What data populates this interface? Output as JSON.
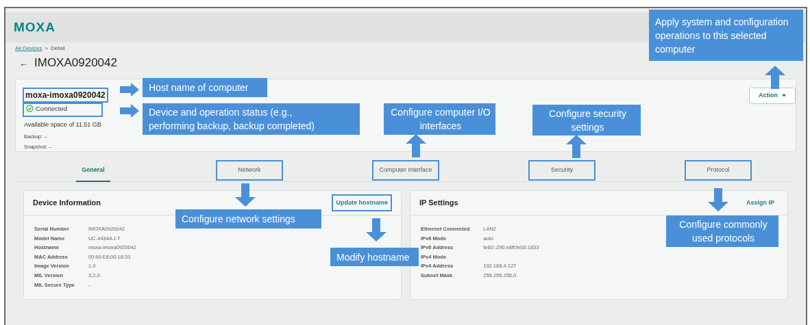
{
  "header": {
    "logo": "MOXA"
  },
  "breadcrumb": {
    "link": "All Devices",
    "separator": ">",
    "current": "Detail"
  },
  "page_title": {
    "back": "←",
    "title": "IMOXA0920042"
  },
  "summary": {
    "hostname": "moxa-imoxa0920042",
    "hostname_annotated": true,
    "status": "Connected",
    "status_annotated": true,
    "space": "Available space of 11.51 GB",
    "backup": "Backup: --",
    "snapshot": "Snapshot: --",
    "action": "Action"
  },
  "tabs": [
    {
      "label": "General",
      "selected": true,
      "annotated": false
    },
    {
      "label": "Network",
      "selected": false,
      "annotated": true
    },
    {
      "label": "Computer Interface",
      "selected": false,
      "annotated": true
    },
    {
      "label": "Security",
      "selected": false,
      "annotated": true
    },
    {
      "label": "Protocol",
      "selected": false,
      "annotated": true
    }
  ],
  "cards": [
    {
      "title": "Device Information",
      "link": "Update hostname",
      "link_annotated": true,
      "rows": [
        {
          "label": "Serial Number",
          "value": "IMOXA0920042"
        },
        {
          "label": "Model Name",
          "value": "UC-4434A-I-T"
        },
        {
          "label": "Hostname",
          "value": "moxa-imoxa0920042"
        },
        {
          "label": "MAC Address",
          "value": "00:90:E8:00:18:33"
        },
        {
          "label": "Image Version",
          "value": "1.0"
        },
        {
          "label": "MIL Version",
          "value": "3.2.0"
        },
        {
          "label": "MIL Secure Type",
          "value": "-"
        }
      ]
    },
    {
      "title": "IP Settings",
      "link": "Assign IP",
      "link_annotated": false,
      "rows": [
        {
          "label": "Ethernet Connected",
          "value": "LAN2"
        },
        {
          "label": "IPv6 Mode",
          "value": "auto"
        },
        {
          "label": "IPv6 Address",
          "value": "fe80::290:e8ff:fe00:1833"
        },
        {
          "label": "IPv4 Mode",
          "value": ""
        },
        {
          "label": "IPv4 Address",
          "value": "192.168.4.127"
        },
        {
          "label": "Subnet Mask",
          "value": "255.255.255.0"
        }
      ]
    }
  ],
  "annotations": [
    {
      "text": "Host name of computer"
    },
    {
      "text": "Device and operation status (e.g., performing backup, backup completed)"
    },
    {
      "text": "Configure computer I/O interfaces"
    },
    {
      "text": "Configure security settings"
    },
    {
      "text": "Apply system and configuration operations to this selected computer"
    },
    {
      "text": "Configure network settings"
    },
    {
      "text": "Modify hostname"
    },
    {
      "text": "Configure commonly used protocols"
    }
  ]
}
